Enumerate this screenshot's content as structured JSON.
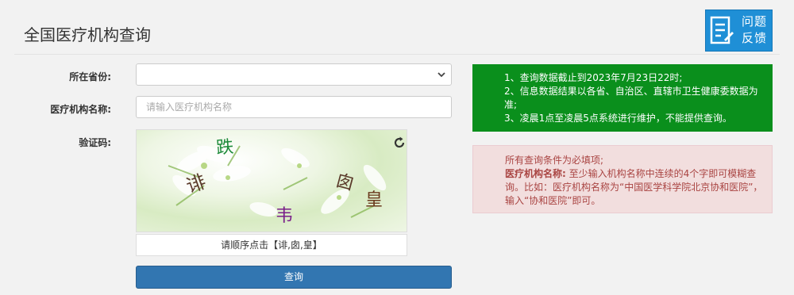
{
  "header": {
    "title": "全国医疗机构查询",
    "feedback_line1": "问题",
    "feedback_line2": "反馈"
  },
  "form": {
    "province_label": "所在省份:",
    "province_selected": "",
    "name_label": "医疗机构名称:",
    "name_placeholder": "请输入医疗机构名称",
    "captcha_label": "验证码:",
    "captcha_chars": [
      "跌",
      "诽",
      "囱",
      "皇",
      "韦"
    ],
    "captcha_colors": [
      "#1d8a3a",
      "#5a3a2a",
      "#5a3a2a",
      "#6b3a1e",
      "#7a1f8a"
    ],
    "captcha_hint": "请顺序点击【诽,囱,皇】",
    "submit_label": "查询"
  },
  "notices": {
    "green_lines": [
      "1、查询数据截止到2023年7月23日22时;",
      "2、信息数据结果以各省、自治区、直辖市卫生健康委数据为准;",
      "3、凌晨1点至凌晨5点系统进行维护，不能提供查询。"
    ],
    "red_intro": "所有查询条件为必填项;",
    "red_bold": "医疗机构名称:",
    "red_rest": " 至少输入机构名称中连续的4个字即可模糊查询。比如：医疗机构名称为“中国医学科学院北京协和医院”，输入“协和医院”即可。"
  },
  "colors": {
    "accent": "#3276b1",
    "notice_green": "#0a8f1c",
    "notice_red_bg": "#f2dede",
    "notice_red_text": "#a94442",
    "feedback_bg": "#1f8fd6"
  },
  "icons": {
    "feedback": "document-icon",
    "refresh": "refresh-icon",
    "dropdown": "chevron-down-icon"
  }
}
